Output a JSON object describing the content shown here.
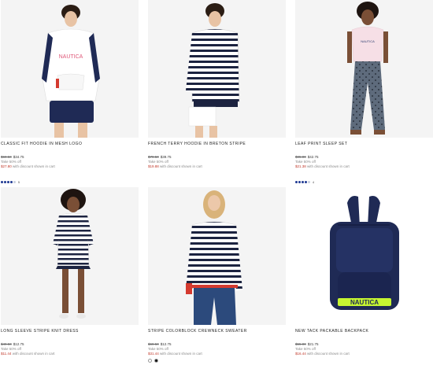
{
  "products": [
    {
      "title": "CLASSIC FIT HOODIE IN MESH LOGO",
      "old_price": "$69.50",
      "new_price": "$34.75",
      "promo": "Take 50% off",
      "sale_price": "$27.80",
      "sale_note": "with discount shown in cart",
      "rating_stars": 4.5,
      "rating_count": "5"
    },
    {
      "title": "FRENCH TERRY HOODIE IN BRETON STRIPE",
      "old_price": "$79.50",
      "new_price": "$39.75",
      "promo": "Take 50% off",
      "sale_price": "$19.88",
      "sale_note": "with discount shown in cart"
    },
    {
      "title": "LEAF PRINT SLEEP SET",
      "old_price": "$85.00",
      "new_price": "$42.75",
      "promo": "Take 50% off",
      "sale_price": "$21.38",
      "sale_note": "with discount shown in cart",
      "rating_stars": 4.5,
      "rating_count": "4"
    },
    {
      "title": "LONG SLEEVE STRIPE KNIT DRESS",
      "old_price": "$49.50",
      "new_price": "$12.75",
      "promo": "Take 50% off",
      "sale_price": "$11.44",
      "sale_note": "with discount shown in cart"
    },
    {
      "title": "STRIPE COLORBLOCK CREWNECK SWEATER",
      "old_price": "$69.50",
      "new_price": "$12.75",
      "promo": "Take 50% off",
      "sale_price": "$31.44",
      "sale_note": "with discount shown in cart",
      "swatches": [
        "#ffffff",
        "#111111"
      ]
    },
    {
      "title": "NEW TACK PACKABLE BACKPACK",
      "old_price": "$55.00",
      "new_price": "$21.75",
      "promo": "Take 50% off",
      "sale_price": "$16.44",
      "sale_note": "with discount shown in cart"
    }
  ],
  "brand_text": "NAUTICA",
  "colors": {
    "navy": "#1f2a55",
    "stripe": "#1c2340",
    "accent_red": "#d43a2f",
    "neon": "#c6f531"
  }
}
